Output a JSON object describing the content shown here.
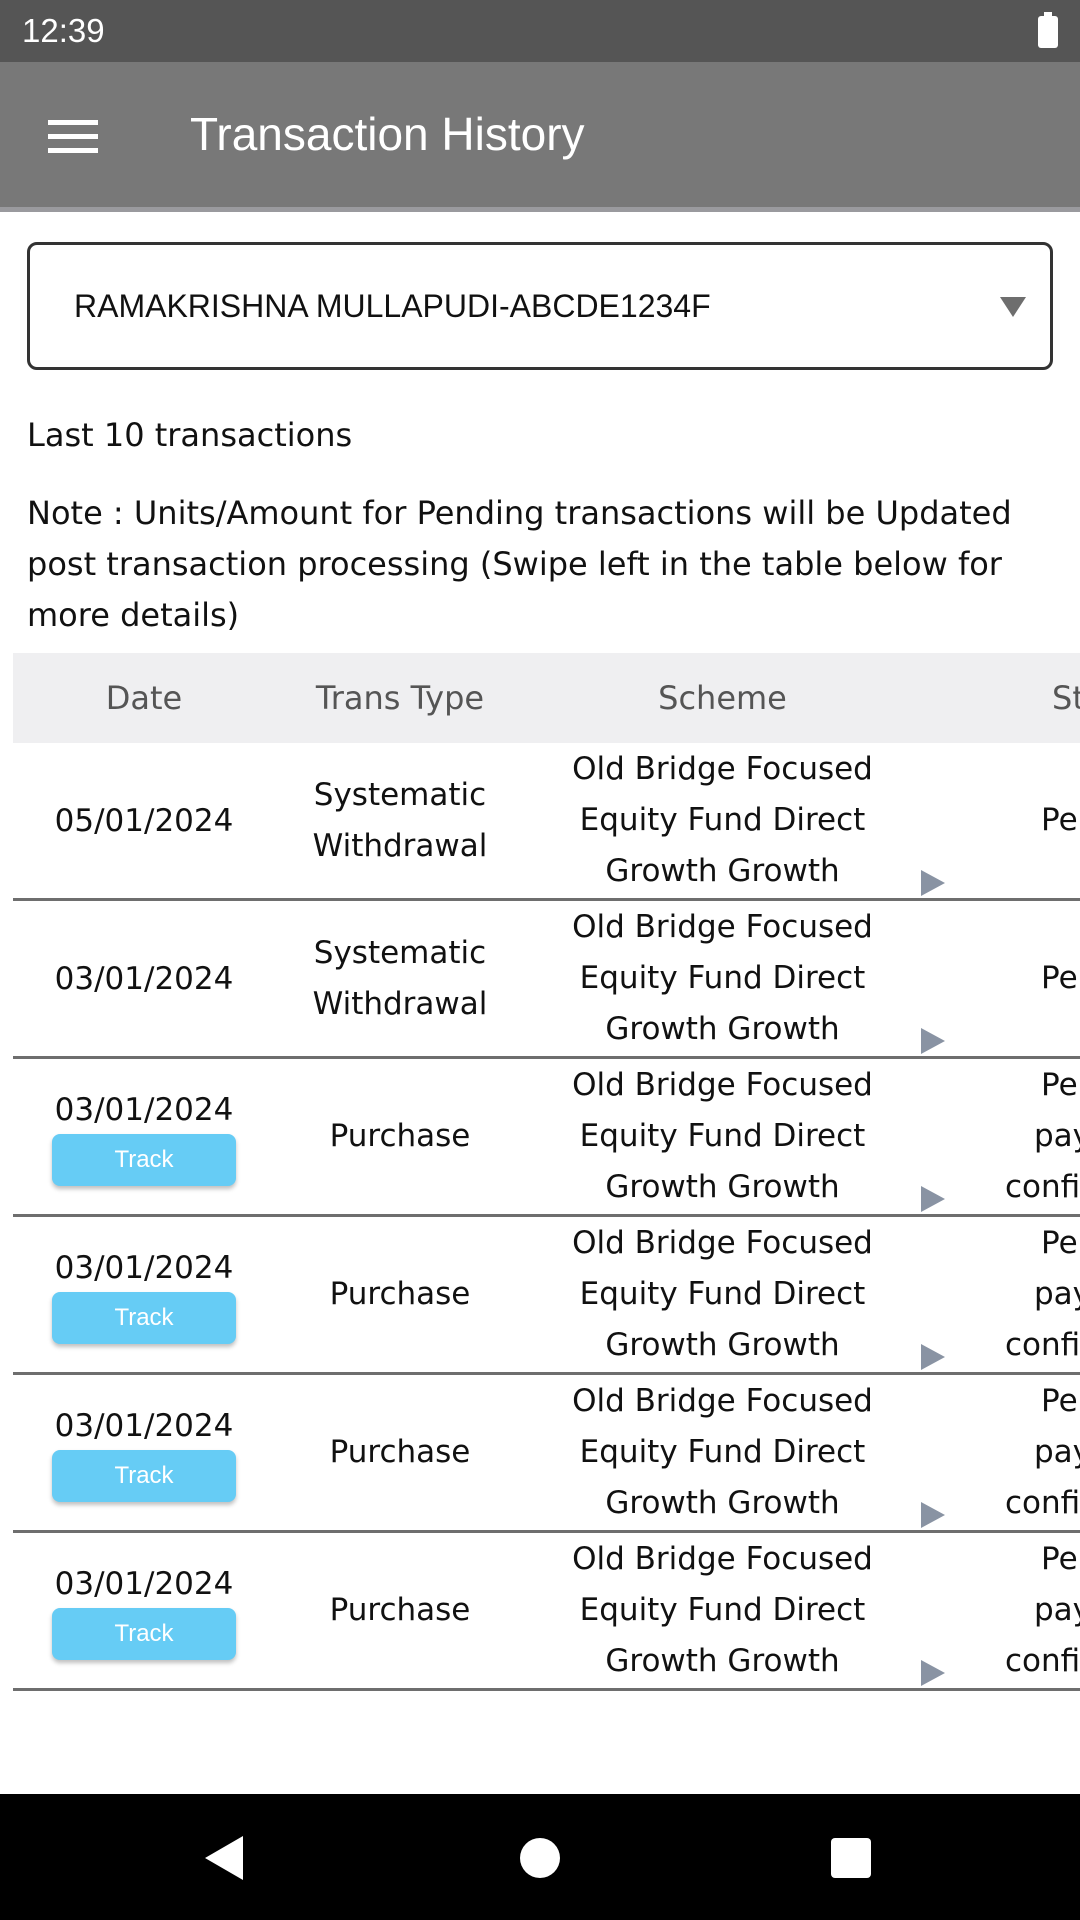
{
  "status_bar": {
    "time": "12:39",
    "battery_icon": "battery-full-icon"
  },
  "app_bar": {
    "title": "Transaction History",
    "menu_icon": "hamburger-menu-icon"
  },
  "investor_select": {
    "value": "RAMAKRISHNA MULLAPUDI-ABCDE1234F"
  },
  "summary": {
    "last_label": "Last 10 transactions",
    "note": "Note : Units/Amount for Pending transactions will be Updated post transaction processing (Swipe left in the table below for more details)"
  },
  "table": {
    "headers": [
      "Date",
      "Trans Type",
      "Scheme",
      "Status"
    ],
    "track_label": "Track",
    "rows": [
      {
        "date": "05/01/2024",
        "type": "Systematic Withdrawal",
        "scheme": "Old Bridge Focused Equity Fund Direct Growth Growth",
        "status": "Pending",
        "track": false
      },
      {
        "date": "03/01/2024",
        "type": "Systematic Withdrawal",
        "scheme": "Old Bridge Focused Equity Fund Direct Growth Growth",
        "status": "Pending",
        "track": false
      },
      {
        "date": "03/01/2024",
        "type": "Purchase",
        "scheme": "Old Bridge Focused Equity Fund Direct Growth Growth",
        "status": "Pending payment confirmation",
        "track": true
      },
      {
        "date": "03/01/2024",
        "type": "Purchase",
        "scheme": "Old Bridge Focused Equity Fund Direct Growth Growth",
        "status": "Pending payment confirmation",
        "track": true
      },
      {
        "date": "03/01/2024",
        "type": "Purchase",
        "scheme": "Old Bridge Focused Equity Fund Direct Growth Growth",
        "status": "Pending payment confirmation",
        "track": true
      },
      {
        "date": "03/01/2024",
        "type": "Purchase",
        "scheme": "Old Bridge Focused Equity Fund Direct Growth Growth",
        "status": "Pending payment confirmation",
        "track": true
      }
    ]
  },
  "colors": {
    "app_bar": "#787878",
    "status_bar": "#555555",
    "track_button": "#66ccf5",
    "header_bg": "#efeff1"
  }
}
